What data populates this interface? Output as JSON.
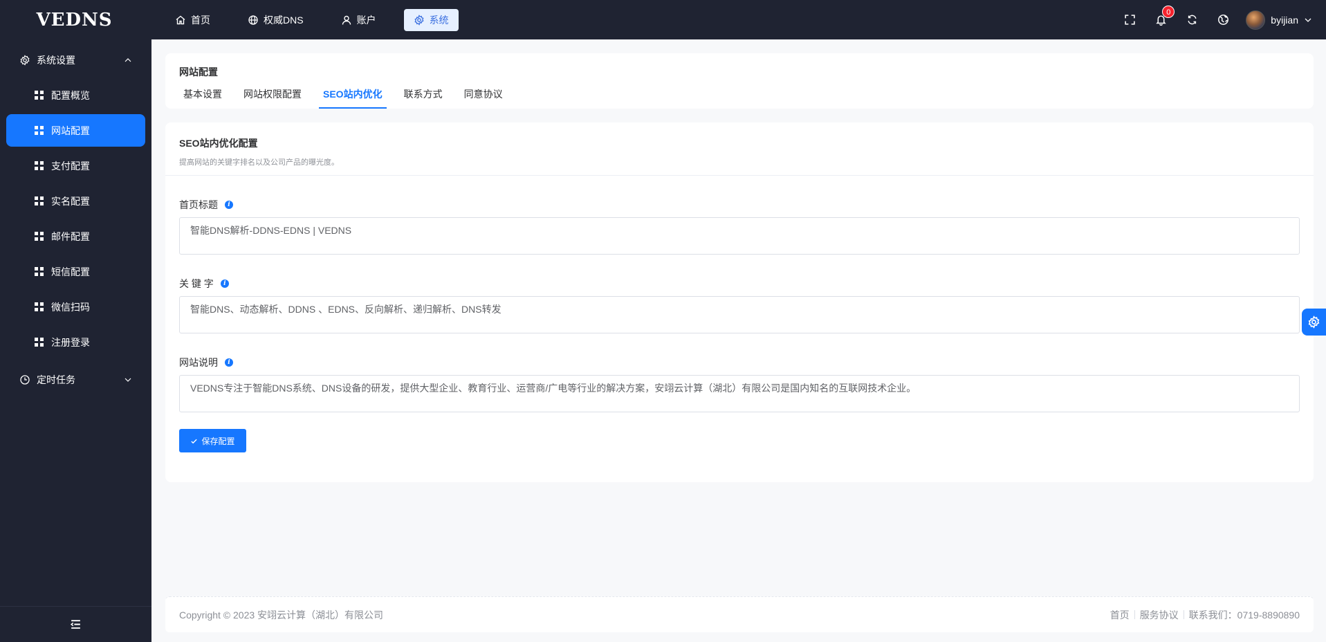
{
  "app": {
    "logo": "VEDNS"
  },
  "nav": [
    {
      "label": "首页",
      "icon": "home-icon"
    },
    {
      "label": "权威DNS",
      "icon": "globe-icon"
    },
    {
      "label": "账户",
      "icon": "user-icon"
    },
    {
      "label": "系统",
      "icon": "gear-icon",
      "active": true
    }
  ],
  "topbar": {
    "notification_count": "0",
    "username": "byijian"
  },
  "sidebar": {
    "group1": "系统设置",
    "items": [
      "配置概览",
      "网站配置",
      "支付配置",
      "实名配置",
      "邮件配置",
      "短信配置",
      "微信扫码",
      "注册登录"
    ],
    "active_index": 1,
    "group2": "定时任务"
  },
  "page": {
    "title": "网站配置",
    "tabs": [
      "基本设置",
      "网站权限配置",
      "SEO站内优化",
      "联系方式",
      "同意协议"
    ],
    "active_tab": 2
  },
  "seo": {
    "title": "SEO站内优化配置",
    "desc": "提高网站的关键字排名以及公司产品的曝光度。",
    "fields": [
      {
        "label": "首页标题",
        "value": "智能DNS解析-DDNS-EDNS | VEDNS"
      },
      {
        "label": "关 键 字",
        "value": "智能DNS、动态解析、DDNS 、EDNS、反向解析、递归解析、DNS转发"
      },
      {
        "label": "网站说明",
        "value": "VEDNS专注于智能DNS系统、DNS设备的研发，提供大型企业、教育行业、运营商/广电等行业的解决方案，安翊云计算（湖北）有限公司是国内知名的互联网技术企业。"
      }
    ],
    "save_label": "保存配置"
  },
  "footer": {
    "copyright": "Copyright © 2023 安翊云计算（湖北）有限公司",
    "links": [
      "首页",
      "服务协议",
      "联系我们：0719-8890890"
    ]
  },
  "colors": {
    "primary": "#1677ff",
    "sidebar_bg": "#1f2332",
    "badge": "#f5222d"
  }
}
